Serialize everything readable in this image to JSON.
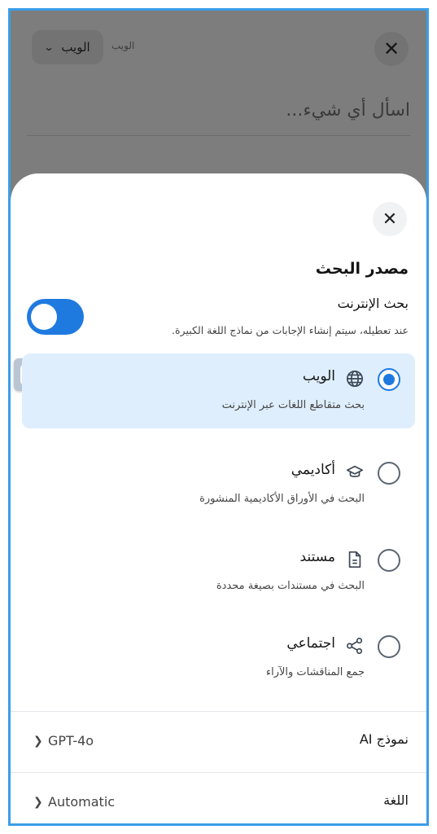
{
  "background": {
    "source_selector_label": "الويب",
    "source_hint": "الويب",
    "search_placeholder": "اسأل أي شيء..."
  },
  "sheet": {
    "title": "مصدر البحث",
    "web_search": {
      "label": "بحث الإنترنت",
      "description": "عند تعطيله، سيتم إنشاء الإجابات من نماذج اللغة الكبيرة.",
      "enabled": true
    },
    "options": [
      {
        "label": "الويب",
        "description": "بحث متقاطع اللغات عبر الإنترنت",
        "icon": "globe-icon",
        "selected": true
      },
      {
        "label": "أكاديمي",
        "description": "البحث في الأوراق الأكاديمية المنشورة",
        "icon": "graduation-cap-icon",
        "selected": false
      },
      {
        "label": "مستند",
        "description": "البحث في مستندات بصيغة محددة",
        "icon": "document-icon",
        "selected": false
      },
      {
        "label": "اجتماعي",
        "description": "جمع المناقشات والآراء",
        "icon": "share-network-icon",
        "selected": false
      }
    ],
    "settings": {
      "model": {
        "label": "نموذج AI",
        "value": "GPT-4o"
      },
      "language": {
        "label": "اللغة",
        "value": "Automatic"
      }
    }
  },
  "colors": {
    "accent": "#1f7ae0",
    "selected_bg": "#deeefc",
    "frame_border": "#3b9ee8"
  }
}
